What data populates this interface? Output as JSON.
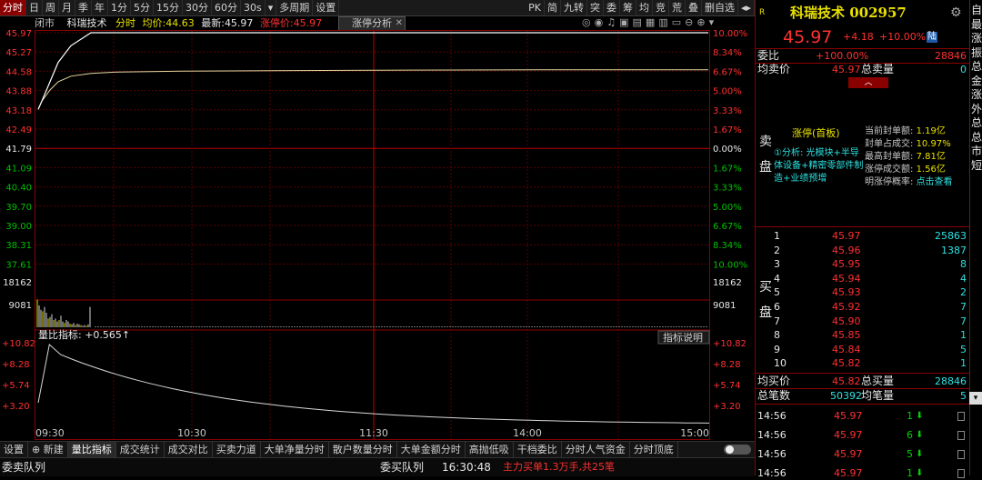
{
  "toolbar": {
    "items": [
      "分时",
      "日",
      "周",
      "月",
      "季",
      "年",
      "1分",
      "5分",
      "15分",
      "30分",
      "60分",
      "30s",
      "▾",
      "多周期",
      "设置"
    ],
    "right": [
      "PK",
      "简",
      "九转",
      "突",
      "委",
      "筹",
      "均",
      "竞",
      "荒",
      "叠",
      "删自选",
      "◂▸"
    ]
  },
  "info": {
    "status": "闭市",
    "name": "科瑞技术",
    "mode": "分时",
    "avg_label": "均价:",
    "avg": "44.63",
    "last_label": "最新:",
    "last": "45.97",
    "limit_label": "涨停价:",
    "limit": "45.97",
    "zt_button": "涨停分析"
  },
  "chart": {
    "left_price_ticks": [
      "45.97",
      "45.27",
      "44.58",
      "43.88",
      "43.18",
      "42.49",
      "41.79",
      "41.09",
      "40.40",
      "39.70",
      "39.00",
      "38.31",
      "37.61"
    ],
    "right_pct_ticks": [
      "10.00%",
      "8.34%",
      "6.67%",
      "5.00%",
      "3.33%",
      "1.67%",
      "0.00%",
      "1.67%",
      "3.33%",
      "5.00%",
      "6.67%",
      "8.34%",
      "10.00%"
    ],
    "vol_ticks": [
      "18162",
      "9081"
    ],
    "ratio_label": "量比指标: +0.565↑",
    "ratio_ticks": [
      "+10.82",
      "+8.28",
      "+5.74",
      "+3.20"
    ],
    "explain": "指标说明",
    "times": [
      "09:30",
      "10:30",
      "11:30",
      "14:00",
      "15:00"
    ]
  },
  "chart_data": {
    "type": "line",
    "series": [
      {
        "values": [
          43.2,
          43.5,
          44.2,
          44.9,
          45.5,
          45.97,
          45.97,
          45.97,
          45.97,
          45.97,
          45.97,
          45.97
        ]
      },
      {
        "values": [
          43.2,
          43.5,
          43.9,
          44.2,
          44.4,
          44.5,
          44.55,
          44.58,
          44.6,
          44.62,
          44.63,
          44.63
        ]
      }
    ],
    "ylim": [
      37.61,
      45.97
    ]
  },
  "quote": {
    "code_icon": "R",
    "title": "科瑞技术 002957",
    "price": "45.97",
    "change": "+4.18",
    "pct": "+10.00%",
    "badge": "陆",
    "wb_label": "委比",
    "wb_val": "+100.00%",
    "wb_count": "28846",
    "avg_sell_label": "均卖价",
    "avg_sell": "45.97",
    "total_sell_label": "总卖量",
    "total_sell": "0",
    "sell_side": "卖盘",
    "zt_title": "涨停(首板)",
    "zt_reason": "①分析: 光模块+半导体设备+精密零部件制造+业绩预增",
    "seal_labels": [
      "当前封单额:",
      "封单占成交:",
      "最高封单额:",
      "涨停成交额:",
      "明涨停概率:"
    ],
    "seal_vals": [
      "1.19亿",
      "10.97%",
      "7.81亿",
      "1.56亿",
      "点击查看"
    ],
    "buy_side": "买盘",
    "bids": [
      {
        "n": "1",
        "p": "45.97",
        "v": "25863"
      },
      {
        "n": "2",
        "p": "45.96",
        "v": "1387"
      },
      {
        "n": "3",
        "p": "45.95",
        "v": "8"
      },
      {
        "n": "4",
        "p": "45.94",
        "v": "4"
      },
      {
        "n": "5",
        "p": "45.93",
        "v": "2"
      },
      {
        "n": "6",
        "p": "45.92",
        "v": "7"
      },
      {
        "n": "7",
        "p": "45.90",
        "v": "7"
      },
      {
        "n": "8",
        "p": "45.85",
        "v": "1"
      },
      {
        "n": "9",
        "p": "45.84",
        "v": "5"
      },
      {
        "n": "10",
        "p": "45.82",
        "v": "1"
      }
    ],
    "avg_buy_label": "均买价",
    "avg_buy": "45.82",
    "total_buy_label": "总买量",
    "total_buy": "28846",
    "total_trades_label": "总笔数",
    "total_trades": "50392",
    "avg_trades_label": "均笔量",
    "avg_trades": "5",
    "ticks": [
      {
        "t": "14:56",
        "p": "45.97",
        "v": "1"
      },
      {
        "t": "14:56",
        "p": "45.97",
        "v": "6"
      },
      {
        "t": "14:56",
        "p": "45.97",
        "v": "5"
      },
      {
        "t": "14:56",
        "p": "45.97",
        "v": "1"
      }
    ],
    "side_chars": [
      "自",
      "最",
      "涨",
      "振",
      "总",
      "金",
      "涨",
      "外",
      "总",
      "总",
      "市",
      "短"
    ]
  },
  "bottom": {
    "tabs": [
      "设置",
      "新建",
      "量比指标",
      "成交统计",
      "成交对比",
      "买卖力道",
      "大单净量分时",
      "散户数量分时",
      "大单金额分时",
      "高抛低吸",
      "干档委比",
      "分时人气资金",
      "分时顶底"
    ],
    "sell_queue": "委卖队列",
    "buy_queue": "委买队列",
    "time": "16:30:48",
    "main_buy": "主力买单1.3万手,共25笔"
  }
}
